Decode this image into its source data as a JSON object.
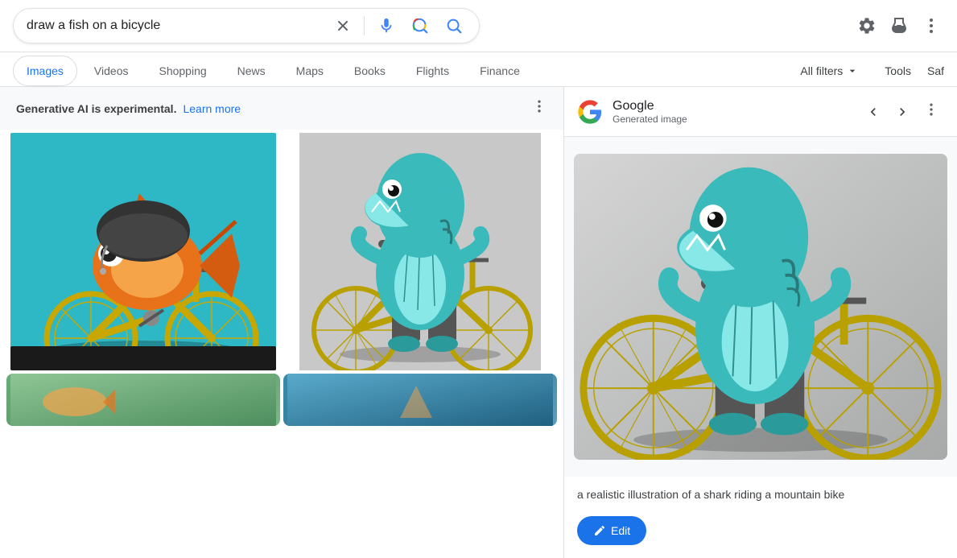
{
  "header": {
    "search_query": "draw a fish on a bicycle",
    "google_logo_letters": [
      "G",
      "o",
      "o",
      "g",
      "l",
      "e"
    ]
  },
  "nav": {
    "tabs": [
      {
        "label": "Images",
        "active": true
      },
      {
        "label": "Videos",
        "active": false
      },
      {
        "label": "Shopping",
        "active": false
      },
      {
        "label": "News",
        "active": false
      },
      {
        "label": "Maps",
        "active": false
      },
      {
        "label": "Books",
        "active": false
      },
      {
        "label": "Flights",
        "active": false
      },
      {
        "label": "Finance",
        "active": false
      }
    ],
    "all_filters_label": "All filters",
    "tools_label": "Tools",
    "safe_label": "Saf"
  },
  "ai_banner": {
    "text_bold": "Generative AI is experimental.",
    "text_link": "Learn more"
  },
  "detail_panel": {
    "source": "Google",
    "subtitle": "Generated image",
    "caption": "a realistic illustration of a shark riding a mountain bike",
    "edit_button_label": "Edit"
  },
  "icons": {
    "clear": "✕",
    "mic": "mic",
    "lens": "lens",
    "search": "🔍",
    "settings": "⚙",
    "flask": "🧪",
    "more_vert": "⋮",
    "chevron_left": "‹",
    "chevron_right": "›",
    "arrow_drop_down": "▾",
    "pencil": "✏"
  }
}
